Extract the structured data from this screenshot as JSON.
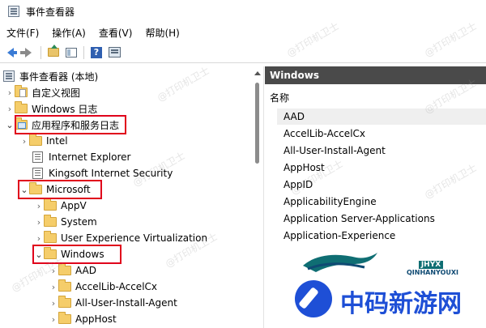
{
  "window": {
    "title": "事件查看器"
  },
  "menu": [
    "文件(F)",
    "操作(A)",
    "查看(V)",
    "帮助(H)"
  ],
  "toolbar": {
    "help_glyph": "?"
  },
  "tree": {
    "root": "事件查看器 (本地)",
    "custom_views": "自定义视图",
    "windows_logs": "Windows 日志",
    "apps_services": "应用程序和服务日志",
    "intel": "Intel",
    "ie": "Internet Explorer",
    "kingsoft": "Kingsoft Internet Security",
    "microsoft": "Microsoft",
    "appv": "AppV",
    "system": "System",
    "uev": "User Experience Virtualization",
    "windows": "Windows",
    "aad": "AAD",
    "accellib": "AccelLib-AccelCx",
    "allusers": "All-User-Install-Agent",
    "apphost": "AppHost"
  },
  "right": {
    "header": "Windows",
    "column": "名称",
    "items": [
      "AAD",
      "AccelLib-AccelCx",
      "All-User-Install-Agent",
      "AppHost",
      "AppID",
      "ApplicabilityEngine",
      "Application Server-Applications",
      "Application-Experience"
    ]
  },
  "watermark": "@打印机卫士",
  "branding": {
    "cn": "中码新游网",
    "en_top": "JHYX",
    "en_bottom": "QINHANYOUXI"
  },
  "colors": {
    "highlight": "#e0001b",
    "header_bg": "#4a4a4a",
    "brand_blue": "#1e4fd6"
  }
}
